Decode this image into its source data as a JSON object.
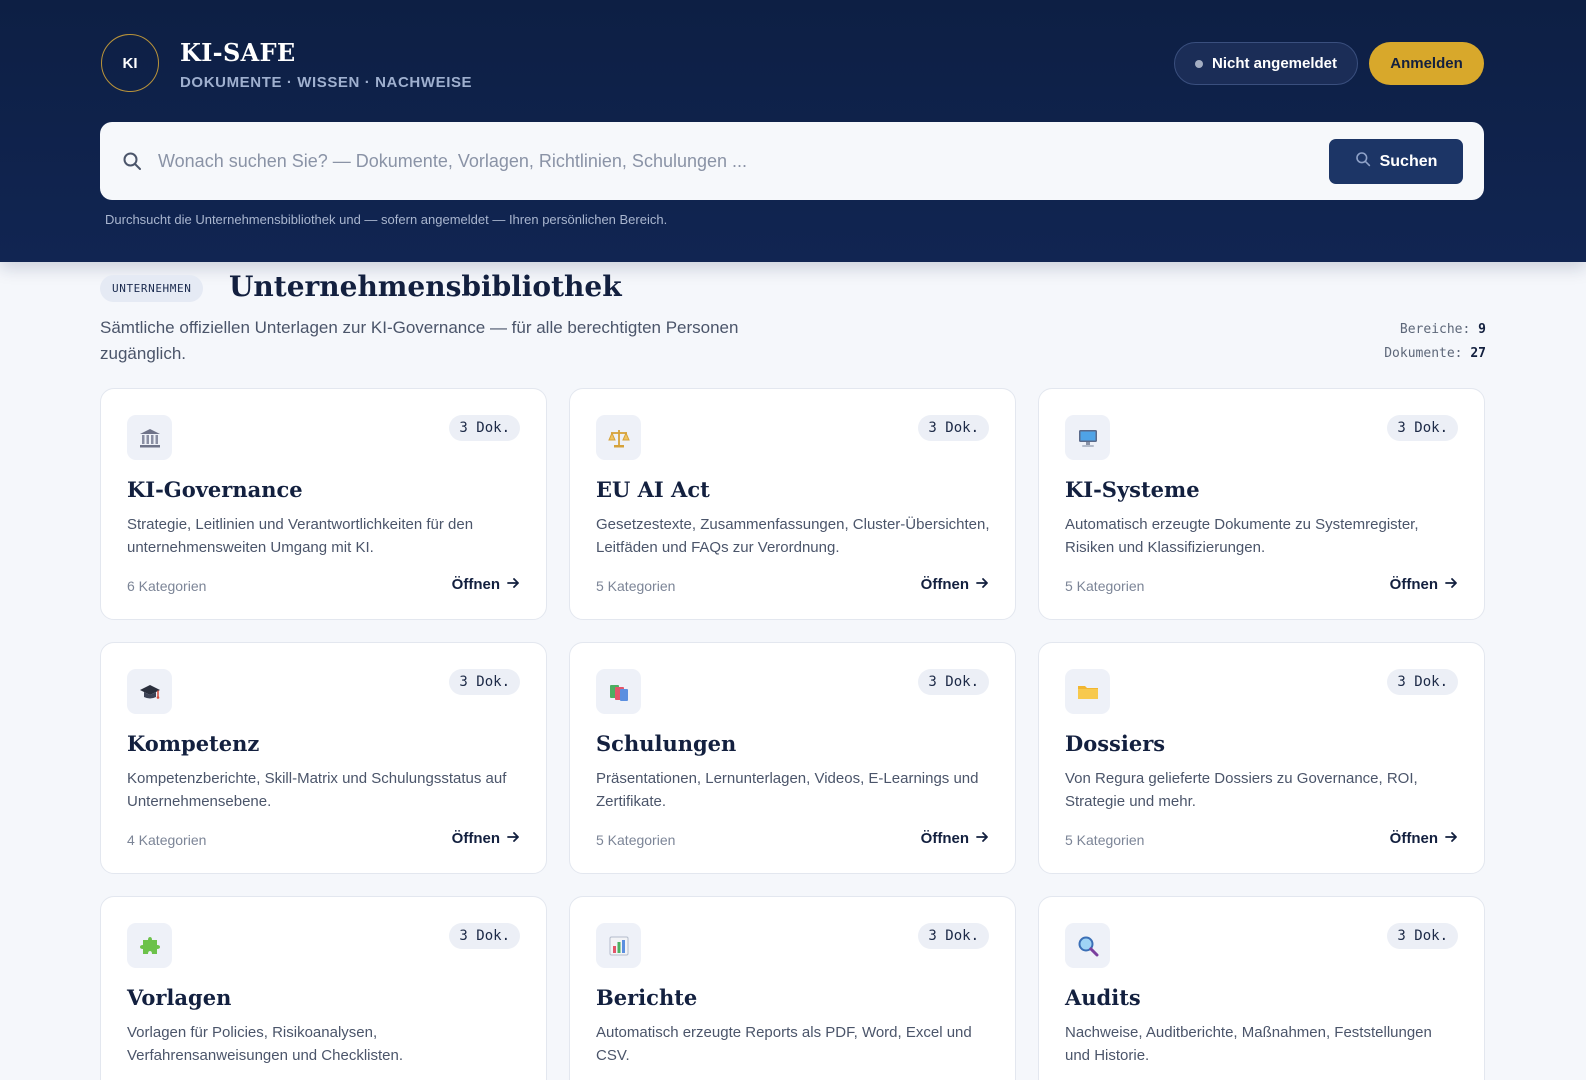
{
  "header": {
    "logo_text": "KI",
    "title": "KI-SAFE",
    "subtitle": "DOKUMENTE · WISSEN · NACHWEISE",
    "status_label": "Nicht angemeldet",
    "login_label": "Anmelden"
  },
  "search": {
    "placeholder": "Wonach suchen Sie? — Dokumente, Vorlagen, Richtlinien, Schulungen ...",
    "button_label": "Suchen",
    "hint": "Durchsucht die Unternehmensbibliothek und — sofern angemeldet — Ihren persönlichen Bereich."
  },
  "section": {
    "badge": "UNTERNEHMEN",
    "title": "Unternehmensbibliothek",
    "description": "Sämtliche offiziellen Unterlagen zur KI-Governance — für alle berechtigten Personen zugänglich.",
    "stats": {
      "areas_label": "Bereiche:",
      "areas_value": "9",
      "docs_label": "Dokumente:",
      "docs_value": "27"
    }
  },
  "cards": [
    {
      "icon": "bank-icon",
      "badge": "3 Dok.",
      "title": "KI-Governance",
      "desc": "Strategie, Leitlinien und Verantwortlichkeiten für den unternehmensweiten Umgang mit KI.",
      "meta": "6 Kategorien",
      "open": "Öffnen"
    },
    {
      "icon": "scales-icon",
      "badge": "3 Dok.",
      "title": "EU AI Act",
      "desc": "Gesetzestexte, Zusammenfassungen, Cluster-Übersichten, Leitfäden und FAQs zur Verordnung.",
      "meta": "5 Kategorien",
      "open": "Öffnen"
    },
    {
      "icon": "computer-icon",
      "badge": "3 Dok.",
      "title": "KI-Systeme",
      "desc": "Automatisch erzeugte Dokumente zu Systemregister, Risiken und Klassifizierungen.",
      "meta": "5 Kategorien",
      "open": "Öffnen"
    },
    {
      "icon": "graduation-cap-icon",
      "badge": "3 Dok.",
      "title": "Kompetenz",
      "desc": "Kompetenzberichte, Skill-Matrix und Schulungsstatus auf Unternehmensebene.",
      "meta": "4 Kategorien",
      "open": "Öffnen"
    },
    {
      "icon": "books-icon",
      "badge": "3 Dok.",
      "title": "Schulungen",
      "desc": "Präsentationen, Lernunterlagen, Videos, E-Learnings und Zertifikate.",
      "meta": "5 Kategorien",
      "open": "Öffnen"
    },
    {
      "icon": "folder-icon",
      "badge": "3 Dok.",
      "title": "Dossiers",
      "desc": "Von Regura gelieferte Dossiers zu Governance, ROI, Strategie und mehr.",
      "meta": "5 Kategorien",
      "open": "Öffnen"
    },
    {
      "icon": "puzzle-icon",
      "badge": "3 Dok.",
      "title": "Vorlagen",
      "desc": "Vorlagen für Policies, Risikoanalysen, Verfahrensanweisungen und Checklisten.",
      "meta": "",
      "open": ""
    },
    {
      "icon": "bar-chart-icon",
      "badge": "3 Dok.",
      "title": "Berichte",
      "desc": "Automatisch erzeugte Reports als PDF, Word, Excel und CSV.",
      "meta": "",
      "open": ""
    },
    {
      "icon": "magnifier-icon",
      "badge": "3 Dok.",
      "title": "Audits",
      "desc": "Nachweise, Auditberichte, Maßnahmen, Feststellungen und Historie.",
      "meta": "",
      "open": ""
    }
  ]
}
